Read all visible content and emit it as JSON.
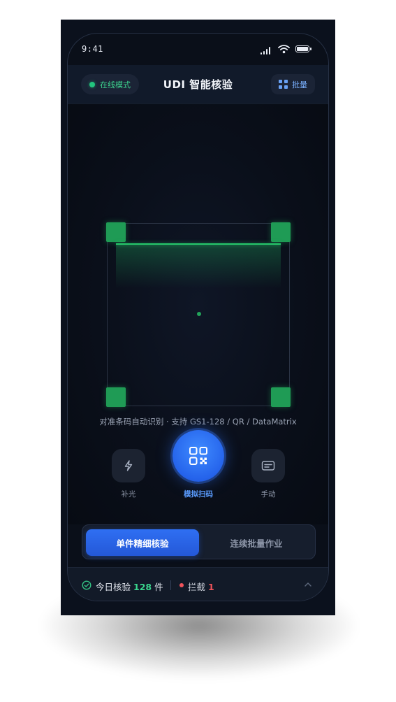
{
  "status_bar": {
    "time": "9:41",
    "icons": [
      "cellular-signal-icon",
      "wifi-icon",
      "battery-icon"
    ]
  },
  "header": {
    "mode_label": "在线模式",
    "title": "UDI 智能核验",
    "batch_label": "批量",
    "icons": {
      "mode": "online-dot-icon",
      "batch": "grid-icon"
    }
  },
  "scanner": {
    "hint": "对准条码自动识别 · 支持 GS1-128 / QR / DataMatrix",
    "controls": {
      "flash_label": "补光",
      "scan_label": "模拟扫码",
      "manual_label": "手动"
    },
    "icons": {
      "flash": "flash-icon",
      "scan": "qr-scan-icon",
      "manual": "keyboard-icon"
    }
  },
  "mode_switch": {
    "active": "单件精细核验",
    "inactive": "连续批量作业"
  },
  "footer": {
    "today_prefix": "今日核验",
    "today_count": "128",
    "today_unit": "件",
    "blocked_label": "拦截",
    "blocked_count": "1",
    "icons": {
      "check": "check-circle-icon",
      "expand": "chevron-up-icon"
    }
  },
  "colors": {
    "accent_blue": "#2563eb",
    "success_green": "#22c57e",
    "danger_red": "#f0535b",
    "scan_green": "#1f9b55",
    "background": "#0a0f19"
  }
}
